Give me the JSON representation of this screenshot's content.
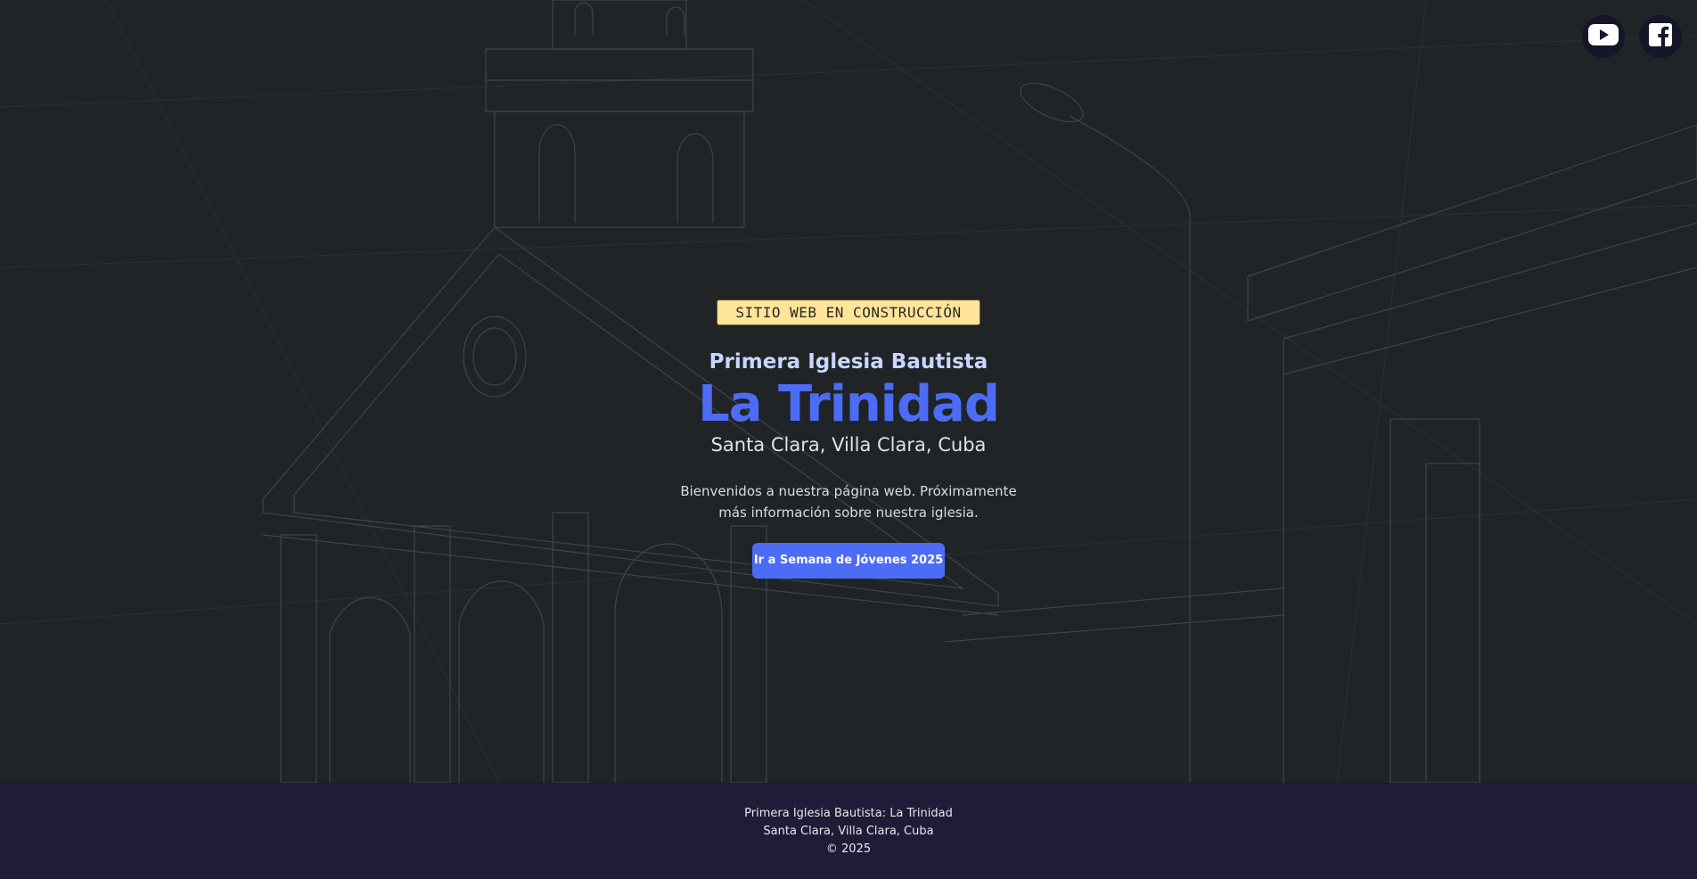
{
  "social": {
    "youtube_icon": "youtube-icon",
    "facebook_icon": "facebook-icon"
  },
  "hero": {
    "badge": "SITIO WEB EN CONSTRUCCIÓN",
    "subtitle": "Primera Iglesia Bautista",
    "title": "La Trinidad",
    "location": "Santa Clara, Villa Clara, Cuba",
    "welcome": "Bienvenidos a nuestra página web. Próximamente más información sobre nuestra iglesia.",
    "cta_label": "Ir a Semana de Jóvenes 2025"
  },
  "footer": {
    "line1": "Primera Iglesia Bautista: La Trinidad",
    "line2": "Santa Clara, Villa Clara, Cuba",
    "line3": "© 2025"
  },
  "colors": {
    "background": "#202427",
    "accent": "#4d6cf5",
    "badge": "#ffe49a",
    "footer": "#1e1c36"
  }
}
